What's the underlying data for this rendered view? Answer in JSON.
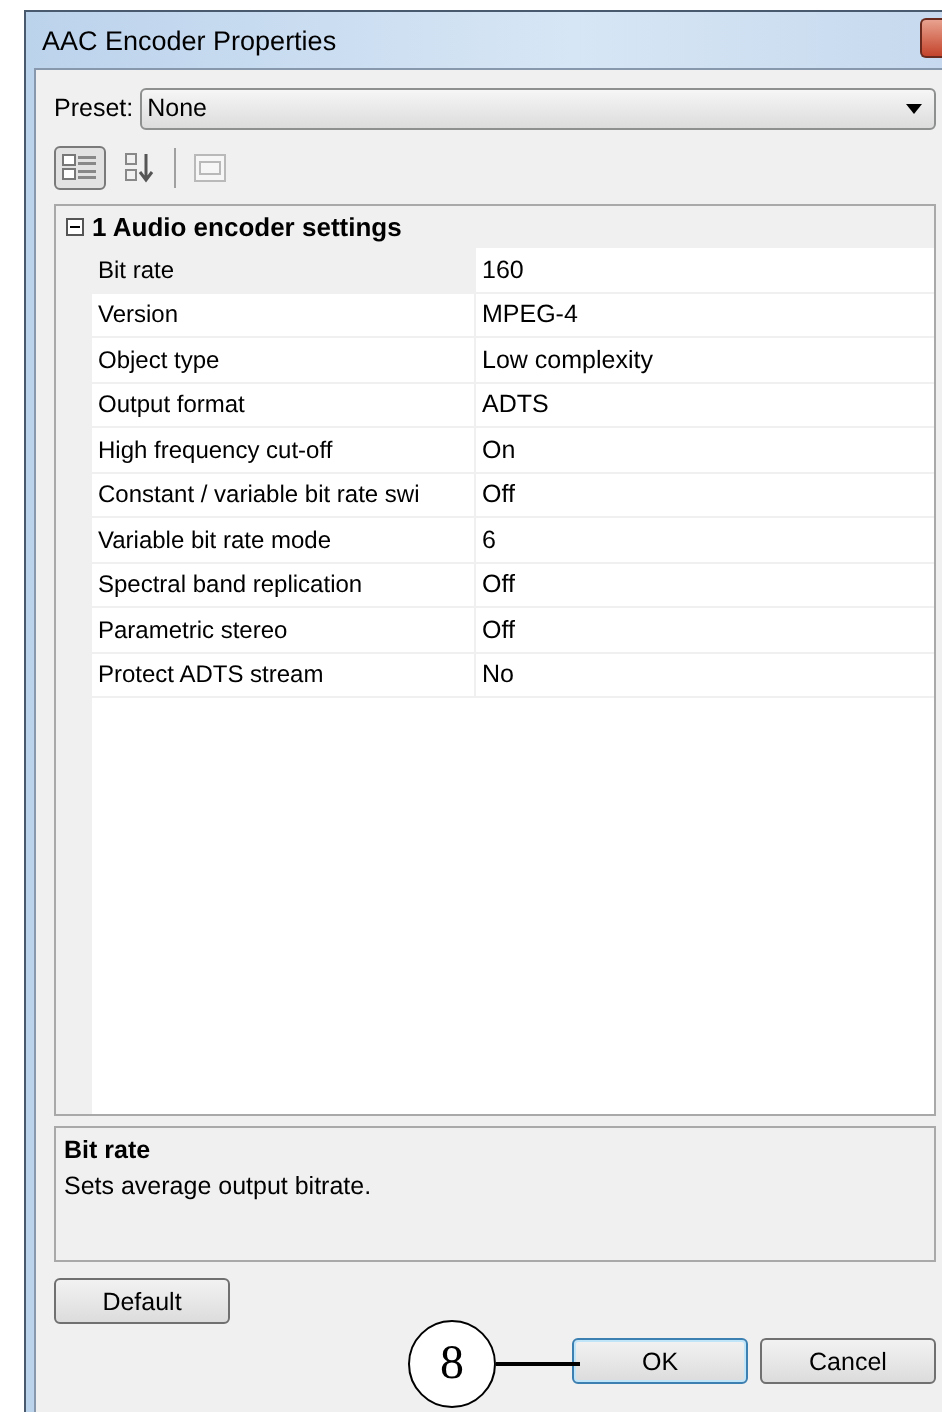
{
  "window": {
    "title": "AAC Encoder Properties"
  },
  "preset": {
    "label": "Preset:",
    "value": "None"
  },
  "toolbar": [
    {
      "kind": "categorized",
      "selected": true,
      "disabled": false
    },
    {
      "kind": "alphabetical",
      "selected": false,
      "disabled": false
    },
    {
      "kind": "separator"
    },
    {
      "kind": "pages",
      "selected": false,
      "disabled": true
    }
  ],
  "category": {
    "title": "1 Audio encoder settings",
    "expanded": true,
    "rows": [
      {
        "name": "Bit rate",
        "value": "160",
        "selected": true
      },
      {
        "name": "Version",
        "value": "MPEG-4",
        "selected": false
      },
      {
        "name": "Object type",
        "value": "Low complexity",
        "selected": false
      },
      {
        "name": "Output format",
        "value": "ADTS",
        "selected": false
      },
      {
        "name": "High frequency cut-off",
        "value": "On",
        "selected": false
      },
      {
        "name": "Constant / variable bit rate swi",
        "value": "Off",
        "selected": false
      },
      {
        "name": "Variable bit rate mode",
        "value": "6",
        "selected": false
      },
      {
        "name": "Spectral band replication",
        "value": "Off",
        "selected": false
      },
      {
        "name": "Parametric stereo",
        "value": "Off",
        "selected": false
      },
      {
        "name": "Protect ADTS stream",
        "value": "No",
        "selected": false
      }
    ]
  },
  "description": {
    "title": "Bit rate",
    "text": "Sets average output bitrate."
  },
  "buttons": [
    {
      "kind": "left",
      "label": "Default",
      "default": false
    },
    {
      "kind": "right",
      "label": "OK",
      "default": true
    },
    {
      "kind": "right",
      "label": "Cancel",
      "default": false
    }
  ],
  "callout": {
    "label": "8"
  }
}
